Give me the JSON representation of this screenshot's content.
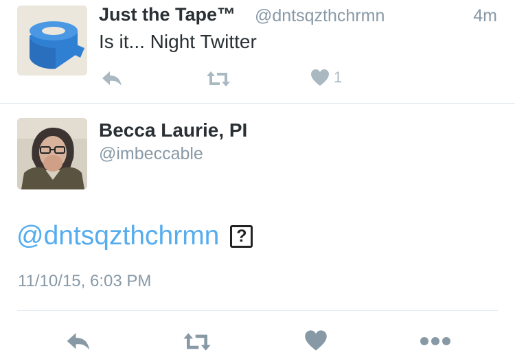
{
  "previous_tweet": {
    "author_name": "Just the Tape™",
    "author_handle": "@dntsqzthchrmn",
    "time_ago": "4m",
    "text": "Is it... Night Twitter",
    "like_count": "1"
  },
  "main_tweet": {
    "author_name": "Becca Laurie, PI",
    "author_handle": "@imbeccable",
    "mention": "@dntsqzthchrmn",
    "unknown_glyph": "?",
    "timestamp": "11/10/15, 6:03 PM"
  },
  "icons": {
    "reply": "reply-icon",
    "retweet": "retweet-icon",
    "like": "heart-icon",
    "more": "more-icon"
  },
  "colors": {
    "text": "#292f33",
    "muted": "#8899a6",
    "link": "#55acee",
    "divider": "#e1e8ed"
  }
}
